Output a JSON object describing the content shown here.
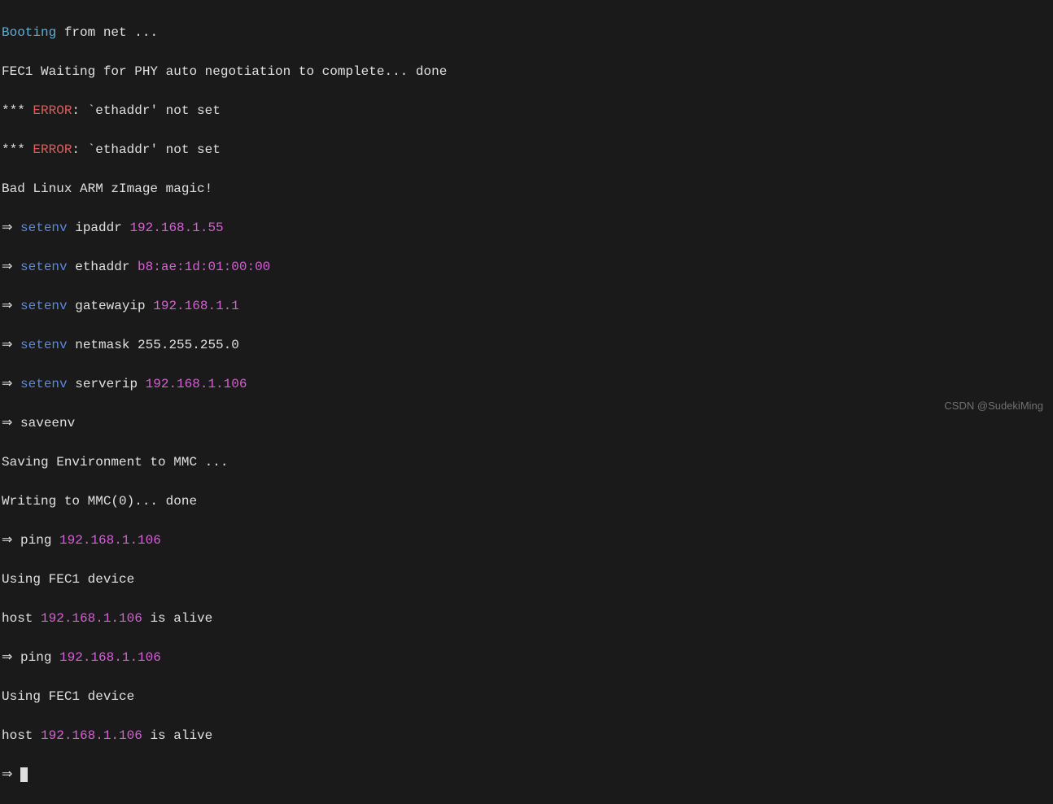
{
  "lines": {
    "l1_booting": "Booting",
    "l1_rest": " from net ...",
    "l2": "FEC1 Waiting for PHY auto negotiation to complete... done",
    "l3_stars": "*** ",
    "l3_error": "ERROR",
    "l3_rest": ": `ethaddr' not set",
    "l4_stars": "*** ",
    "l4_error": "ERROR",
    "l4_rest": ": `ethaddr' not set",
    "l5": "Bad Linux ARM zImage magic!",
    "l6_arrow": "⇒ ",
    "l6_cmd": "setenv",
    "l6_arg": " ipaddr ",
    "l6_val": "192.168.1.55",
    "l7_arrow": "⇒ ",
    "l7_cmd": "setenv",
    "l7_arg": " ethaddr ",
    "l7_val": "b8:ae:1d:01:00:00",
    "l8_arrow": "⇒ ",
    "l8_cmd": "setenv",
    "l8_arg": " gatewayip ",
    "l8_val": "192.168.1.1",
    "l9_arrow": "⇒ ",
    "l9_cmd": "setenv",
    "l9_arg": " netmask 255.255.255.0",
    "l10_arrow": "⇒ ",
    "l10_cmd": "setenv",
    "l10_arg": " serverip ",
    "l10_val": "192.168.1.106",
    "l11_arrow": "⇒ ",
    "l11_cmd": "saveenv",
    "l12": "Saving Environment to MMC ...",
    "l13": "Writing to MMC(0)... done",
    "l14_arrow": "⇒ ",
    "l14_cmd": "ping ",
    "l14_val": "192.168.1.106",
    "l15": "Using FEC1 device",
    "l16_host": "host ",
    "l16_ip": "192.168.1.106",
    "l16_rest": " is alive",
    "l17_arrow": "⇒ ",
    "l17_cmd": "ping ",
    "l17_val": "192.168.1.106",
    "l18": "Using FEC1 device",
    "l19_host": "host ",
    "l19_ip": "192.168.1.106",
    "l19_rest": " is alive",
    "l20_arrow": "⇒ "
  },
  "watermark": "CSDN @SudekiMing"
}
